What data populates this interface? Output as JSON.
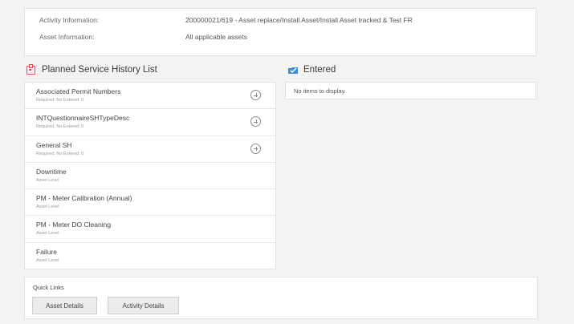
{
  "info": {
    "activity_label": "Activity Information:",
    "activity_value": "200000021/619 - Asset replace/Install Asset/Install Asset tracked & Test FR",
    "asset_label": "Asset Information:",
    "asset_value": "All applicable assets"
  },
  "planned": {
    "title": "Planned Service History List",
    "items": [
      {
        "title": "Associated Permit Numbers",
        "sub": "Required: No   Entered: 0"
      },
      {
        "title": "INTQuestionnaireSHTypeDesc",
        "sub": "Required: No   Entered: 0"
      },
      {
        "title": "General SH",
        "sub": "Required: No   Entered: 0"
      },
      {
        "title": "Downtime",
        "sub": "Asset Level"
      },
      {
        "title": "PM - Meter Calibration (Annual)",
        "sub": "Asset Level"
      },
      {
        "title": "PM - Meter DO Cleaning",
        "sub": "Asset Level"
      },
      {
        "title": "Failure",
        "sub": "Asset Level"
      }
    ]
  },
  "entered": {
    "title": "Entered",
    "empty_message": "No items to display."
  },
  "quick_links": {
    "title": "Quick Links",
    "asset_details": "Asset Details",
    "activity_details": "Activity Details"
  },
  "icons": {
    "planned": "clipboard-icon",
    "entered": "checked-folder-icon",
    "add": "plus-circle-icon"
  },
  "colors": {
    "planned_icon": "#d9534f",
    "entered_icon": "#3b8fd6"
  }
}
